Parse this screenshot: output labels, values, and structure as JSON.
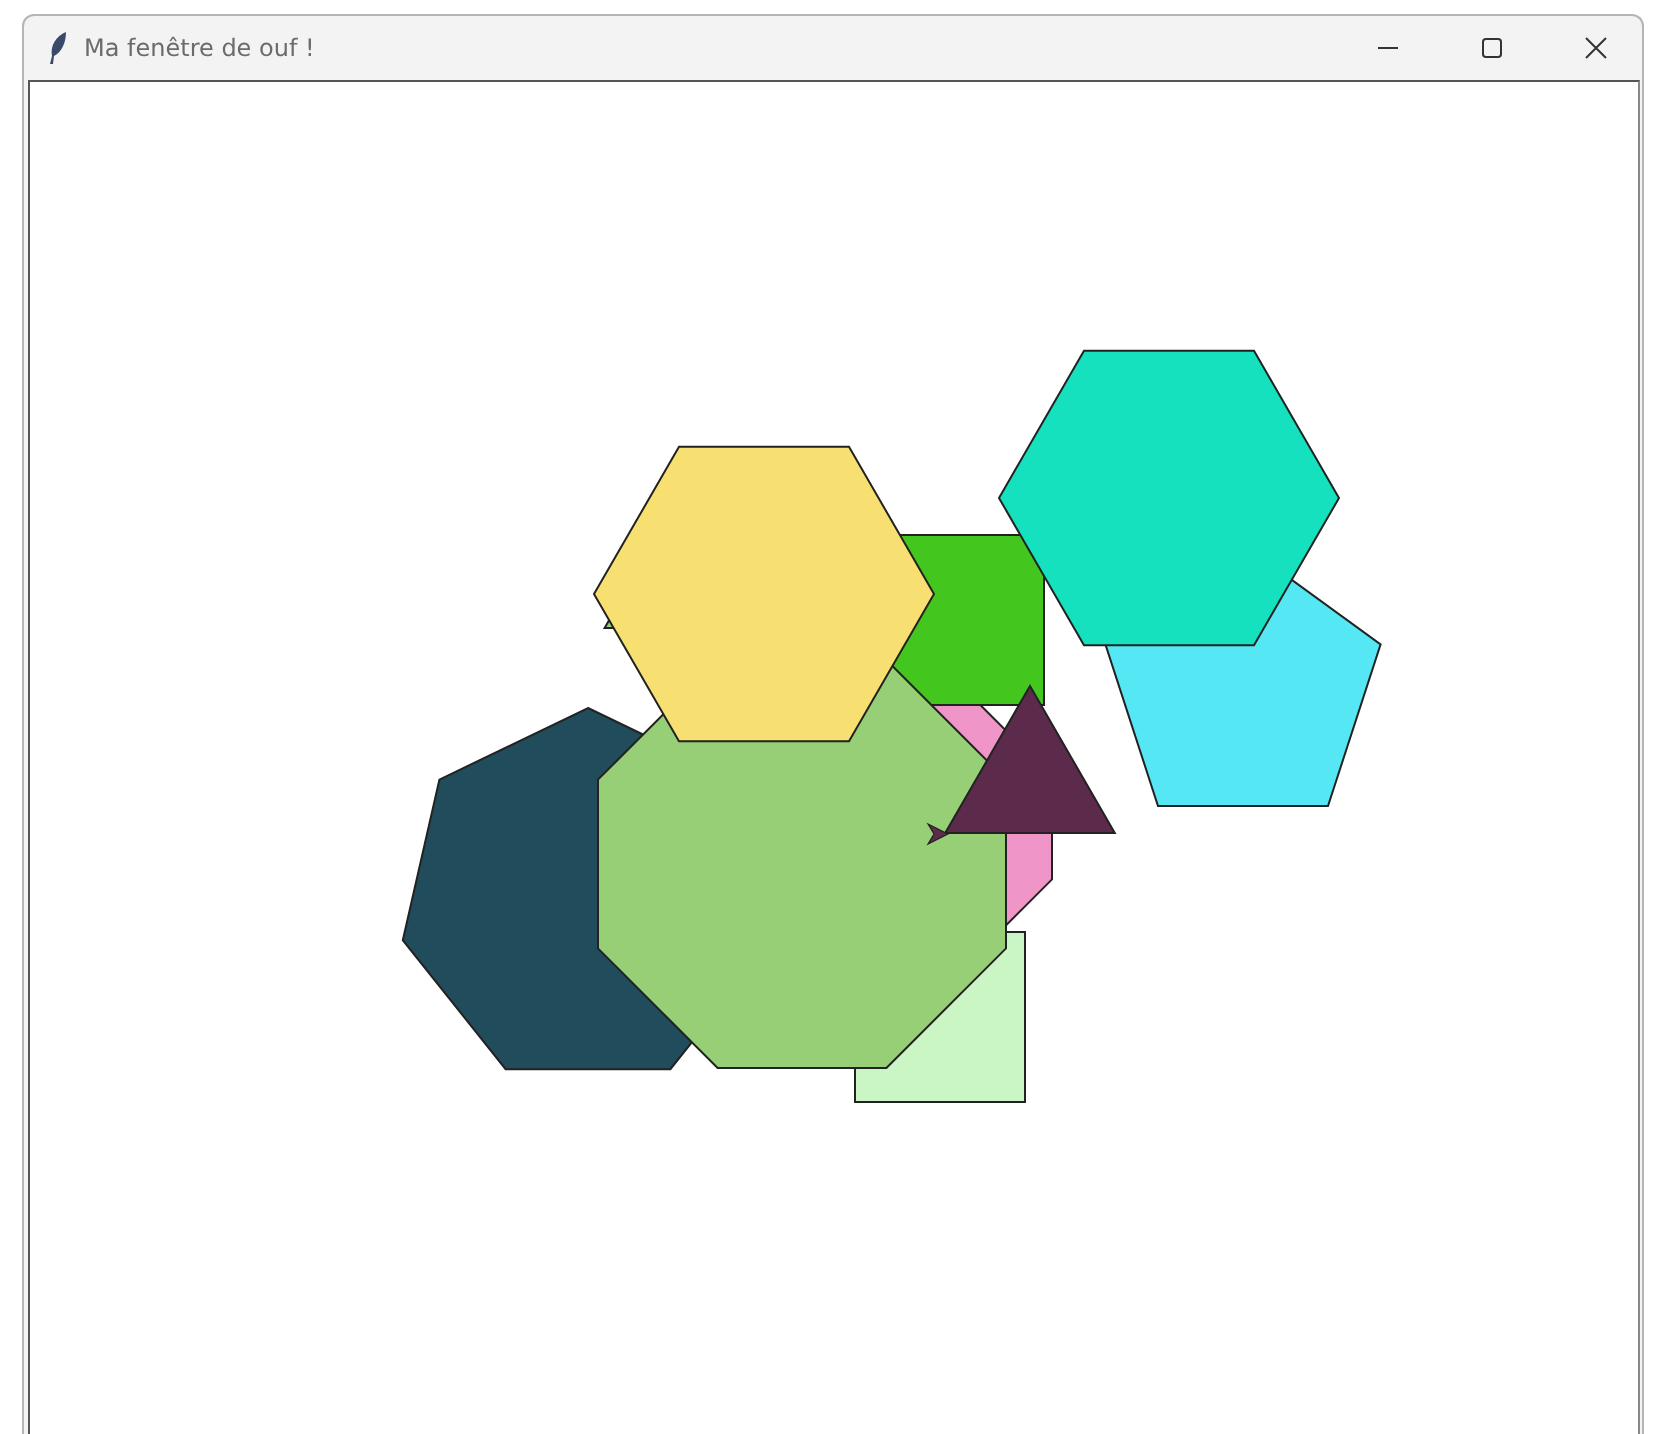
{
  "window": {
    "title": "Ma fenêtre de ouf !"
  },
  "canvas": {
    "shapes": [
      {
        "kind": "heptagon",
        "color": "#214c5c"
      },
      {
        "kind": "octagon",
        "color": "#f095c8"
      },
      {
        "kind": "square",
        "color": "#caf5c5"
      },
      {
        "kind": "square",
        "color": "#43c71e"
      },
      {
        "kind": "triangle",
        "color": "#96cf75"
      },
      {
        "kind": "octagon",
        "color": "#96cf75"
      },
      {
        "kind": "hexagon",
        "color": "#f8df71"
      },
      {
        "kind": "triangle",
        "color": "#5c2a4b"
      },
      {
        "kind": "pentagon",
        "color": "#55e7f4"
      },
      {
        "kind": "hexagon",
        "color": "#16e1bf"
      }
    ]
  }
}
